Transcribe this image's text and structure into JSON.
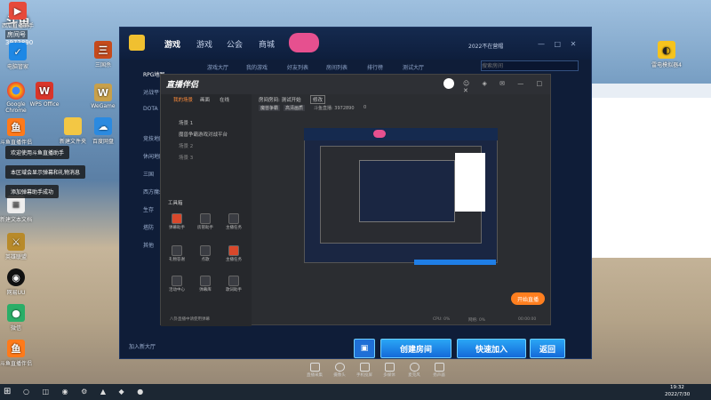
{
  "desktop": {
    "watermark": "斗鱼",
    "room_label": "房间号",
    "room_id": "3972890",
    "icons": [
      {
        "label": "西瓜直播助手",
        "icon": "video-app-icon",
        "color": "#e64a3b"
      },
      {
        "label": "电脑管家",
        "icon": "shield-icon",
        "color": "#1e88e5"
      },
      {
        "label": "Google Chrome",
        "icon": "chrome-icon",
        "color": "#fbbc05"
      },
      {
        "label": "斗鱼直播伴侣",
        "icon": "douyu-icon",
        "color": "#ff7a1a"
      },
      {
        "label": "新建文本文档",
        "icon": "text-file-icon",
        "color": "#eeeeee"
      },
      {
        "label": "英雄联盟",
        "icon": "game-icon",
        "color": "#b88a2a"
      },
      {
        "label": "网易UU",
        "icon": "penguin-icon",
        "color": "#111111"
      },
      {
        "label": "微信",
        "icon": "wechat-icon",
        "color": "#2aae67"
      },
      {
        "label": "WPS Office",
        "icon": "wps-icon",
        "color": "#d9352a"
      },
      {
        "label": "三国杀",
        "icon": "app-icon",
        "color": "#c64a1c"
      },
      {
        "label": "WeGame",
        "icon": "app-icon",
        "color": "#c8a04a"
      },
      {
        "label": "新建文件夹",
        "icon": "folder-icon",
        "color": "#f3c744"
      },
      {
        "label": "百度网盘",
        "icon": "cloud-icon",
        "color": "#2b8ae0"
      },
      {
        "label": "雷电模拟器4",
        "icon": "android-icon",
        "color": "#f6c31d"
      },
      {
        "label": "斗鱼直播伴侣",
        "icon": "douyu-icon",
        "color": "#ff7a1a"
      }
    ],
    "notifications": [
      "欢迎使用斗鱼直播助手",
      "本区域会显示弹幕和礼物消息",
      "添加弹幕助手成功"
    ]
  },
  "game_window": {
    "nav": [
      "游戏",
      "游戏",
      "公会",
      "商城"
    ],
    "active_nav": "游戏",
    "subnav": [
      "游戏大厅",
      "我的游戏",
      "好友列表",
      "房间列表",
      "排行榜",
      "测试大厅"
    ],
    "sidebar": [
      "RPG地图",
      "对战平台",
      "DOTA",
      "竞技地图",
      "休闲地图",
      "三国",
      "西方魔幻",
      "生存",
      "塔防",
      "其他"
    ],
    "user": "2022不在营帽",
    "search_placeholder": "搜索房间",
    "buttons": {
      "create": "创建房间",
      "quick_join": "快速加入",
      "back": "返回"
    },
    "footer": "加入新大厅"
  },
  "streamer": {
    "app_name": "直播伴侣",
    "title_line": "房间房间: 测试开始",
    "title_status": "修改",
    "tags": [
      "魔兽争霸",
      "高清画质"
    ],
    "room_info": "斗鱼直播: 3972890",
    "viewer_count": "0",
    "tabs": [
      "我的场景",
      "画面",
      "在线"
    ],
    "scene_items": [
      "场景 1",
      "魔兽争霸游戏对战平台",
      "场景 2",
      "场景 3"
    ],
    "tools_title": "工具箱",
    "tools": [
      "弹幕助手",
      "房管助手",
      "主播任务",
      "礼物答谢",
      "点歌",
      "主播任务",
      "活动中心",
      "弹幕库",
      "歌词助手"
    ],
    "danmu_tip": "八卦直播中请使用弹幕",
    "bottom_tools": [
      "直播采集",
      "摄像头",
      "手机投屏",
      "多媒体",
      "麦克风",
      "扬声器"
    ],
    "start_button": "开始直播",
    "status": [
      "CPU: 0%",
      "网络: 0%",
      "00:00:00"
    ]
  },
  "taskbar": {
    "time": "19:32",
    "date": "2022/7/30"
  }
}
